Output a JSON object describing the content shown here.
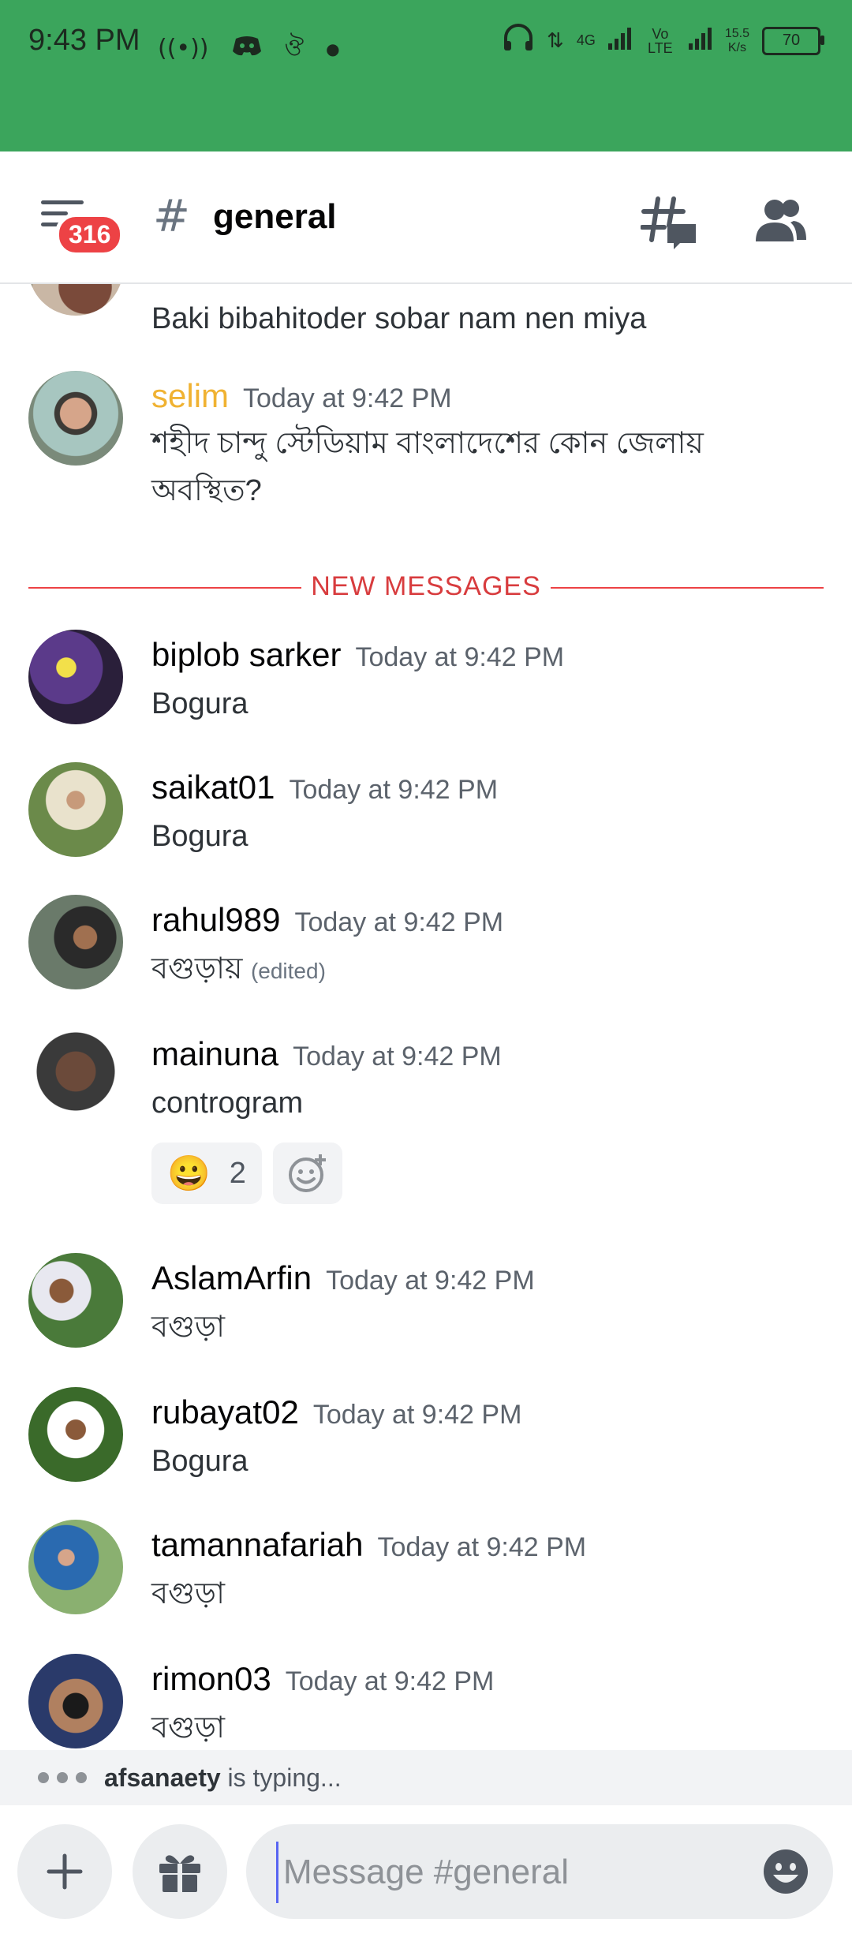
{
  "status_bar": {
    "time": "9:43 PM",
    "left_icons": [
      "hotspot-icon",
      "discord-icon",
      "app-icon",
      "dot-icon"
    ],
    "network_4g": "4G",
    "network_volte": "Vo LTE",
    "speed_value": "15.5",
    "speed_unit": "K/s",
    "battery": "70"
  },
  "header": {
    "hash": "#",
    "channel": "general",
    "unread_badge": "316"
  },
  "messages": [
    {
      "username": "",
      "timestamp": "",
      "text": "Baki bibahitoder sobar nam nen miya"
    },
    {
      "username": "selim",
      "timestamp": "Today at 9:42 PM",
      "text_line1": "শহীদ চান্দু স্টেডিয়াম বাংলাদেশের কোন জেলায়",
      "text_line2": "অবস্থিত?"
    },
    {
      "username": "biplob sarker",
      "timestamp": "Today at 9:42 PM",
      "text": "Bogura"
    },
    {
      "username": "saikat01",
      "timestamp": "Today at 9:42 PM",
      "text": "Bogura"
    },
    {
      "username": "rahul989",
      "timestamp": "Today at 9:42 PM",
      "text": "বগুড়ায়",
      "edited": "(edited)"
    },
    {
      "username": "mainuna",
      "timestamp": "Today at 9:42 PM",
      "text": "controgram",
      "reaction_emoji": "😀",
      "reaction_count": "2"
    },
    {
      "username": "AslamArfin",
      "timestamp": "Today at 9:42 PM",
      "text": "বগুড়া"
    },
    {
      "username": "rubayat02",
      "timestamp": "Today at 9:42 PM",
      "text": "Bogura"
    },
    {
      "username": "tamannafariah",
      "timestamp": "Today at 9:42 PM",
      "text": "বগুড়া"
    },
    {
      "username": "rimon03",
      "timestamp": "Today at 9:42 PM",
      "text": "বগুড়া"
    }
  ],
  "divider": {
    "label": "NEW MESSAGES"
  },
  "typing": {
    "user": "afsanaety",
    "suffix": " is typing..."
  },
  "composer": {
    "placeholder": "Message #general"
  },
  "colors": {
    "status_bar": "#3ba55c",
    "badge": "#ed4245",
    "new_messages": "#d83c3e",
    "selim_name": "#f0b232",
    "cursor": "#5865f2"
  }
}
